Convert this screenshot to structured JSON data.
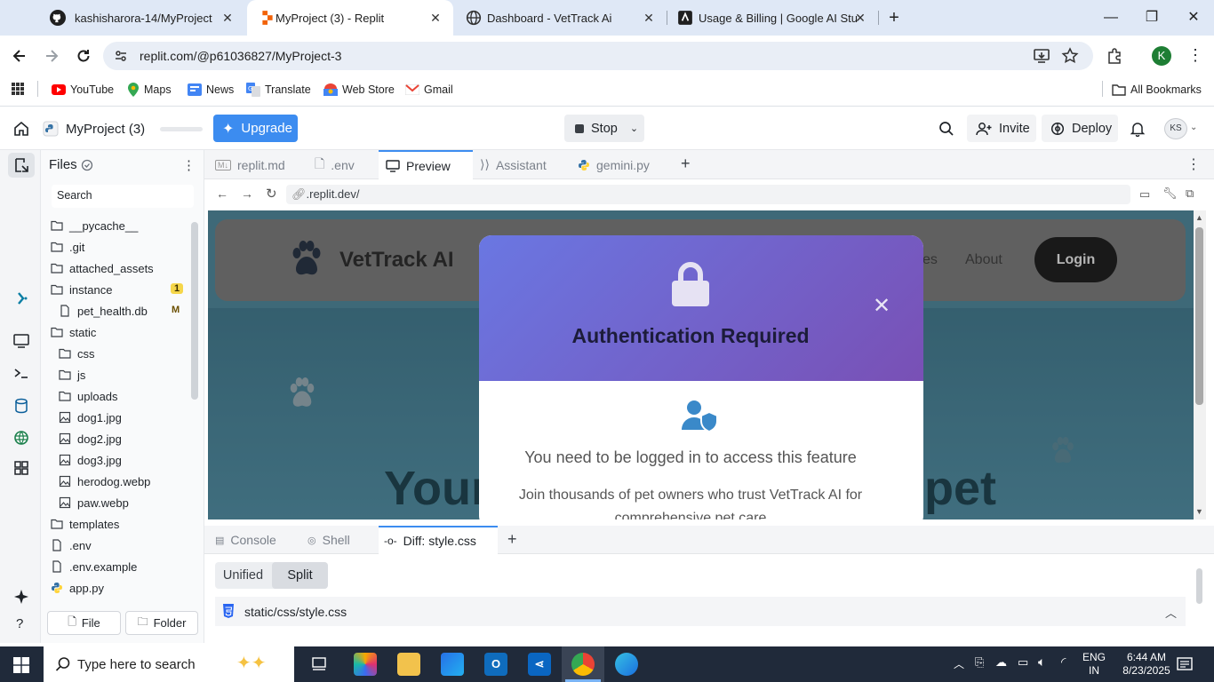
{
  "browser": {
    "tabs": [
      {
        "title": "kashisharora-14/MyProject",
        "icon": "github-icon"
      },
      {
        "title": "MyProject (3) - Replit",
        "icon": "replit-icon",
        "active": true
      },
      {
        "title": "Dashboard - VetTrack Ai",
        "icon": "globe-icon"
      },
      {
        "title": "Usage & Billing | Google AI Stu",
        "icon": "google-ai-studio-icon"
      }
    ],
    "url": "replit.com/@p61036827/MyProject-3",
    "bookmarks": [
      "YouTube",
      "Maps",
      "News",
      "Translate",
      "Web Store",
      "Gmail"
    ],
    "all_bookmarks": "All Bookmarks",
    "profile_initial": "K"
  },
  "replit": {
    "project_name": "MyProject (3)",
    "upgrade_label": "Upgrade",
    "stop_label": "Stop",
    "invite_label": "Invite",
    "deploy_label": "Deploy",
    "avatar_initials": "KS",
    "files_title": "Files",
    "search_placeholder": "Search",
    "file_tree": [
      {
        "name": "__pycache__",
        "type": "folder",
        "depth": 0
      },
      {
        "name": ".git",
        "type": "folder",
        "depth": 0
      },
      {
        "name": "attached_assets",
        "type": "folder",
        "depth": 0
      },
      {
        "name": "instance",
        "type": "folder",
        "depth": 0,
        "badge": "1"
      },
      {
        "name": "pet_health.db",
        "type": "file",
        "depth": 1,
        "badge": "M"
      },
      {
        "name": "static",
        "type": "folder",
        "depth": 0
      },
      {
        "name": "css",
        "type": "folder",
        "depth": 1
      },
      {
        "name": "js",
        "type": "folder",
        "depth": 1
      },
      {
        "name": "uploads",
        "type": "folder",
        "depth": 1
      },
      {
        "name": "dog1.jpg",
        "type": "image",
        "depth": 1
      },
      {
        "name": "dog2.jpg",
        "type": "image",
        "depth": 1
      },
      {
        "name": "dog3.jpg",
        "type": "image",
        "depth": 1
      },
      {
        "name": "herodog.webp",
        "type": "image",
        "depth": 1
      },
      {
        "name": "paw.webp",
        "type": "image",
        "depth": 1
      },
      {
        "name": "templates",
        "type": "folder",
        "depth": 0
      },
      {
        "name": ".env",
        "type": "file",
        "depth": 0
      },
      {
        "name": ".env.example",
        "type": "file",
        "depth": 0
      },
      {
        "name": "app.py",
        "type": "python",
        "depth": 0
      }
    ],
    "new_file_label": "File",
    "new_folder_label": "Folder",
    "editor_tabs": [
      "replit.md",
      ".env",
      "Preview",
      "Assistant",
      "gemini.py"
    ],
    "active_editor_tab": "Preview",
    "preview_url": ".replit.dev/",
    "bottom_tabs": [
      "Console",
      "Shell",
      "Diff: style.css"
    ],
    "active_bottom_tab": "Diff: style.css",
    "diff_modes": [
      "Unified",
      "Split"
    ],
    "active_diff_mode": "Split",
    "diff_file": "static/css/style.css"
  },
  "site": {
    "brand": "VetTrack AI",
    "nav_partial": "es",
    "nav_about": "About",
    "login_label": "Login",
    "hero_left": "Your",
    "hero_right": "r pet",
    "modal": {
      "title": "Authentication Required",
      "message": "You need to be logged in to access this feature",
      "sub_line1": "Join thousands of pet owners who trust VetTrack AI for",
      "sub_line2": "comprehensive pet care"
    }
  },
  "taskbar": {
    "search_placeholder": "Type here to search",
    "lang1": "ENG",
    "lang2": "IN",
    "time": "6:44 AM",
    "date": "8/23/2025"
  },
  "colors": {
    "accent": "#3c8cf0",
    "modal_gradient_start": "#6a77e2",
    "modal_gradient_end": "#7950b5",
    "taskbar": "#202a3a"
  }
}
